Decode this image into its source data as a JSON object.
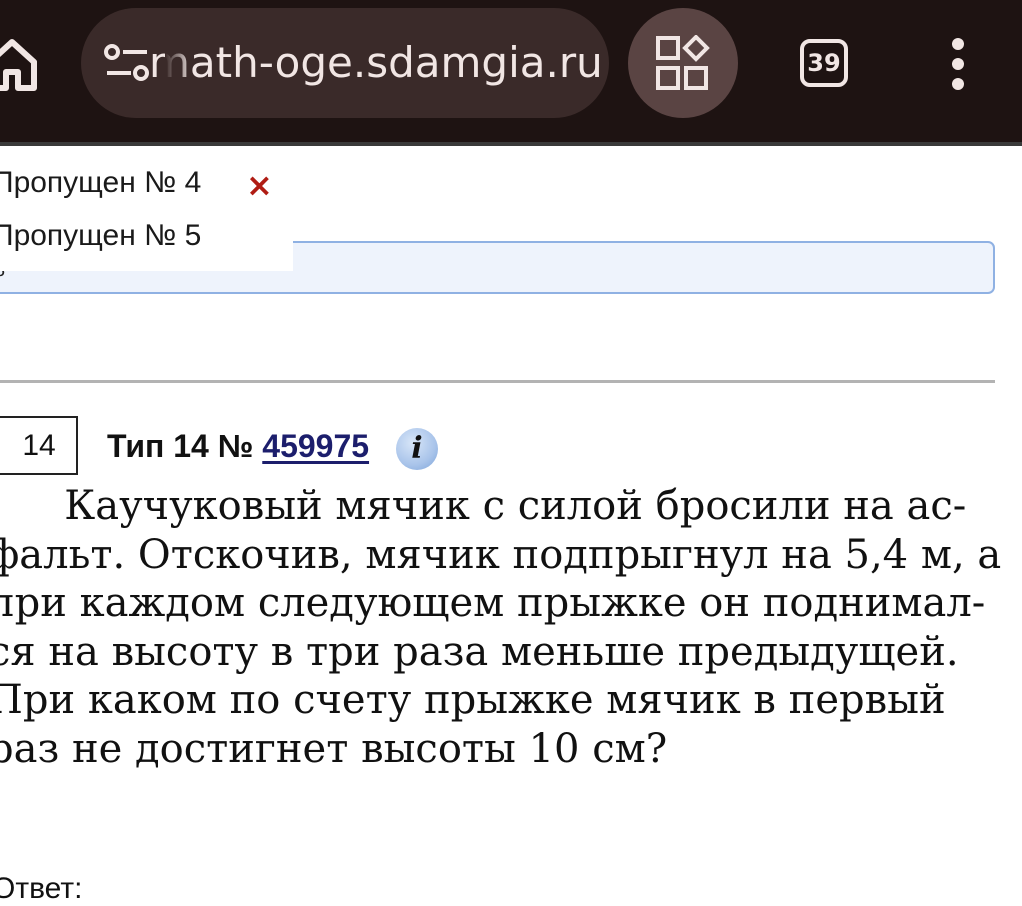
{
  "browser": {
    "url": "math-oge.sdamgia.ru",
    "tab_count": "39",
    "icons": {
      "home": "home-icon",
      "site_settings": "tune-icon",
      "apps": "apps-icon",
      "menu": "more-vert-icon"
    }
  },
  "dropdown": {
    "items": [
      "Пропущен № 4",
      "Пропущен № 5"
    ],
    "close_symbol": "×"
  },
  "answer_field": {
    "visible_char": "8"
  },
  "task": {
    "number": "14",
    "type_prefix": "Тип 14 № ",
    "id": "459975",
    "info_symbol": "i",
    "lines": [
      "      Каучуковый мячик с силой бросили на ас-",
      "фальт. Отскочив, мячик подпрыгнул на 5,4 м, а",
      "при каждом следующем прыжке он поднимал-",
      "ся на высоту в три раза меньше предыдущей.",
      "При каком по счету прыжке мячик в первый",
      "раз не достигнет высоты 10 см?"
    ],
    "answer_label": "Ответ:"
  },
  "colors": {
    "topbar": "#1e1312",
    "url_pill": "#3a2a29",
    "close_red": "#b01c14",
    "link": "#1c1e6c",
    "field_border": "#8fb1e3"
  }
}
